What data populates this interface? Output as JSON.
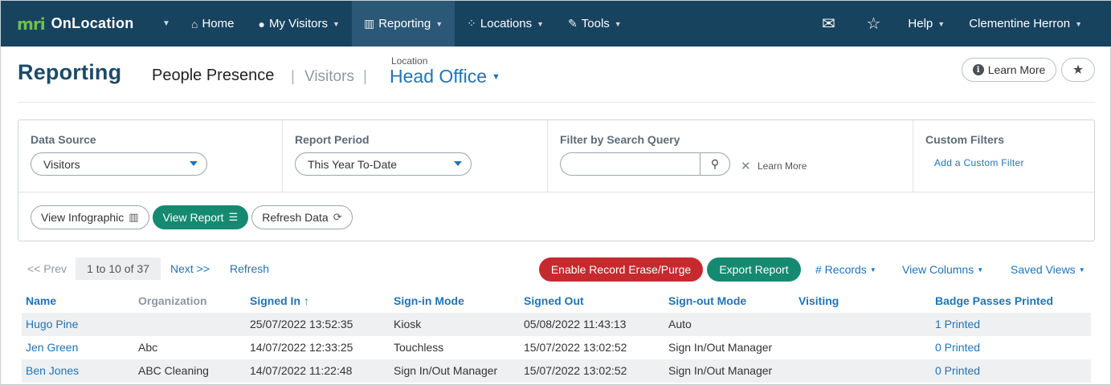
{
  "nav": {
    "brand_logo": "mri",
    "brand_name": "OnLocation",
    "items": [
      {
        "label": "Home",
        "icon": "home-icon",
        "glyph": "⌂"
      },
      {
        "label": "My Visitors",
        "icon": "user-icon",
        "glyph": "👤"
      },
      {
        "label": "Reporting",
        "icon": "bar-chart-icon",
        "glyph": "📊"
      },
      {
        "label": "Locations",
        "icon": "network-icon",
        "glyph": "⁘"
      },
      {
        "label": "Tools",
        "icon": "wrench-icon",
        "glyph": "🔧"
      }
    ],
    "help_label": "Help",
    "user_name": "Clementine Herron"
  },
  "header": {
    "title": "Reporting",
    "tab_current": "People Presence",
    "tab_other": "Visitors",
    "location_label": "Location",
    "location_value": "Head Office",
    "learn_more": "Learn More"
  },
  "filters": {
    "data_source_label": "Data Source",
    "data_source_value": "Visitors",
    "report_period_label": "Report Period",
    "report_period_value": "This Year To-Date",
    "search_label": "Filter by Search Query",
    "search_value": "",
    "search_learn_more": "Learn More",
    "custom_label": "Custom Filters",
    "custom_link": "Add a Custom Filter"
  },
  "view_buttons": {
    "infographic": "View Infographic",
    "report": "View Report",
    "refresh": "Refresh Data"
  },
  "pager": {
    "prev": "<< Prev",
    "info": "1 to 10 of 37",
    "next": "Next >>",
    "refresh": "Refresh"
  },
  "actions": {
    "erase": "Enable Record Erase/Purge",
    "export": "Export Report",
    "records": "# Records",
    "view_columns": "View Columns",
    "saved_views": "Saved Views"
  },
  "table": {
    "columns": [
      {
        "label": "Name",
        "muted": false
      },
      {
        "label": "Organization",
        "muted": true
      },
      {
        "label": "Signed In ↑",
        "muted": false
      },
      {
        "label": "Sign-in Mode",
        "muted": false
      },
      {
        "label": "Signed Out",
        "muted": false
      },
      {
        "label": "Sign-out Mode",
        "muted": false
      },
      {
        "label": "Visiting",
        "muted": false
      },
      {
        "label": "Badge Passes Printed",
        "muted": false
      }
    ],
    "rows": [
      [
        "Hugo Pine",
        "",
        "25/07/2022 13:52:35",
        "Kiosk",
        "05/08/2022 11:43:13",
        "Auto",
        "",
        "1 Printed"
      ],
      [
        "Jen Green",
        "Abc",
        "14/07/2022 12:33:25",
        "Touchless",
        "15/07/2022 13:02:52",
        "Sign In/Out Manager",
        "",
        "0 Printed"
      ],
      [
        "Ben Jones",
        "ABC Cleaning",
        "14/07/2022 11:22:48",
        "Sign In/Out Manager",
        "15/07/2022 13:02:52",
        "Sign In/Out Manager",
        "",
        "0 Printed"
      ]
    ]
  },
  "colors": {
    "nav_bg": "#18435f",
    "nav_active": "#2c5877",
    "brand_green": "#6cc04a",
    "link_blue": "#1f74b8",
    "primary_green": "#158a71",
    "danger_red": "#c62a2f"
  }
}
